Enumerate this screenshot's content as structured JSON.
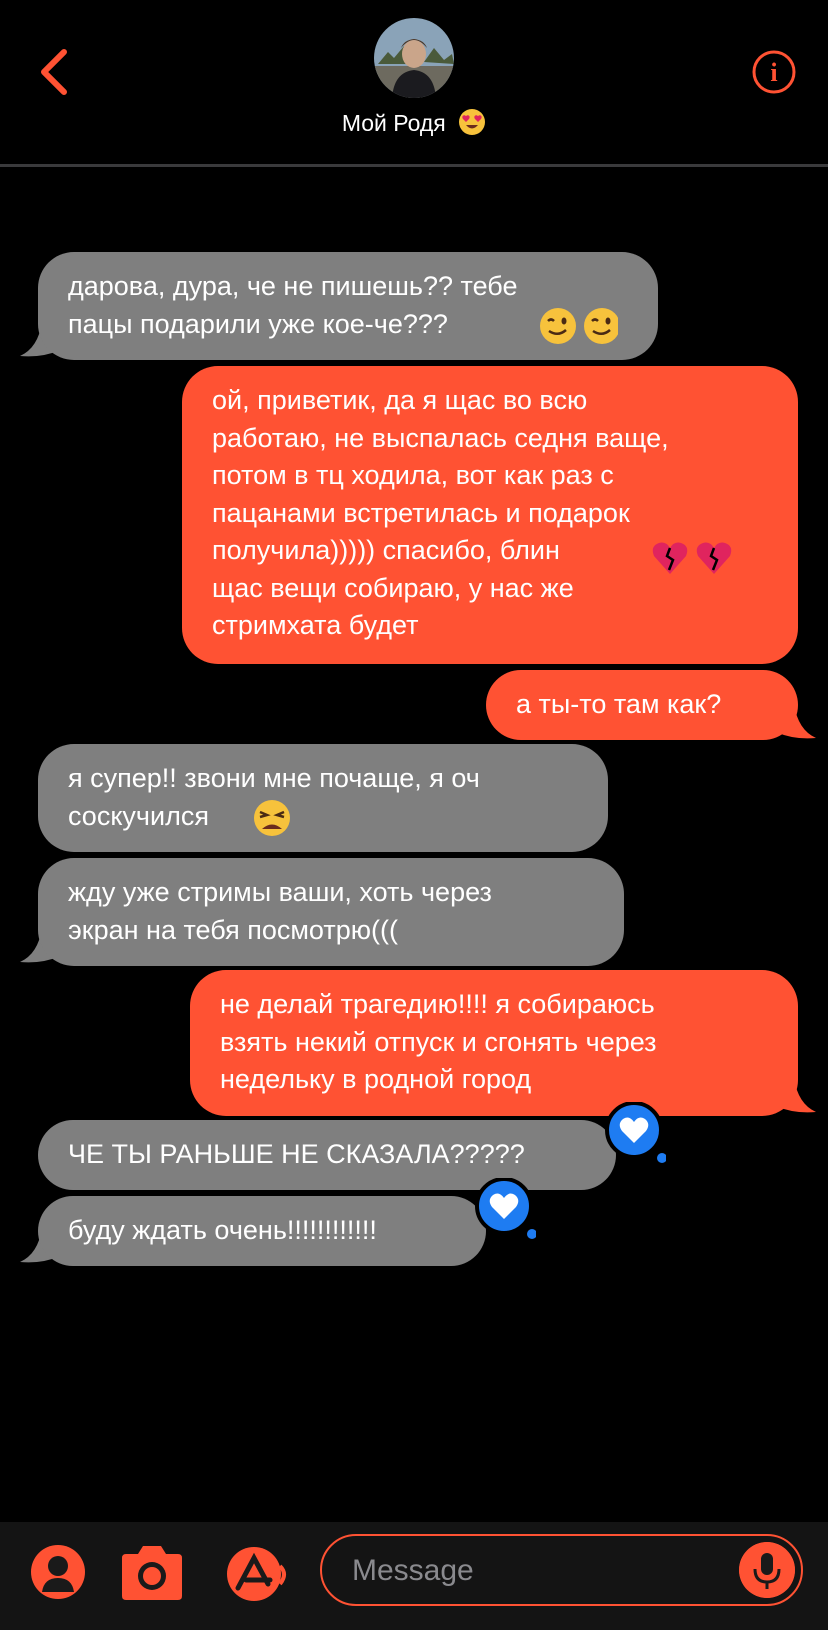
{
  "header": {
    "contact_name": "Мой Родя",
    "back_icon": "chevron-left-icon",
    "info_icon": "info-icon",
    "accent": "#ff5233"
  },
  "messages": [
    {
      "side": "in",
      "text": "дарова, дура, че не пишешь?? тебе\nпацы подарили уже кое-че???",
      "emoji": "wink-face-emoji x2"
    },
    {
      "side": "out",
      "text": "ой, приветик, да я щас во всю\nработаю, не выспалась седня ваще,\nпотом в тц ходила, вот как раз с\nпацанами встретилась и подарок\nполучила))))) спасибо, блин",
      "text2": "щас вещи собираю, у нас же\nстримхата будет",
      "emoji": "broken-heart-emoji x2"
    },
    {
      "side": "out",
      "text": "а ты-то там как?"
    },
    {
      "side": "in",
      "text": "я супер!! звони мне почаще, я оч\nсоскучился",
      "emoji": "weary-face-emoji"
    },
    {
      "side": "in",
      "text": "жду уже стримы ваши, хоть через\nэкран на тебя посмотрю((("
    },
    {
      "side": "out",
      "text": "не делай трагедию!!!! я собираюсь\nвзять некий отпуск и сгонять через\nнедельку в родной город"
    },
    {
      "side": "in",
      "text": "ЧЕ ТЫ РАНЬШЕ НЕ СКАЗАЛА?????",
      "reaction": "heart-reaction-icon"
    },
    {
      "side": "in",
      "text": "буду ждать очень!!!!!!!!!!!!",
      "reaction": "heart-reaction-icon"
    }
  ],
  "composer": {
    "placeholder": "Message",
    "buttons": [
      "contact-icon",
      "camera-icon",
      "app-store-icon",
      "microphone-icon"
    ]
  },
  "colors": {
    "incoming_bubble": "#7f7f7f",
    "outgoing_bubble": "#ff5233",
    "reaction": "#1e7cf2"
  }
}
